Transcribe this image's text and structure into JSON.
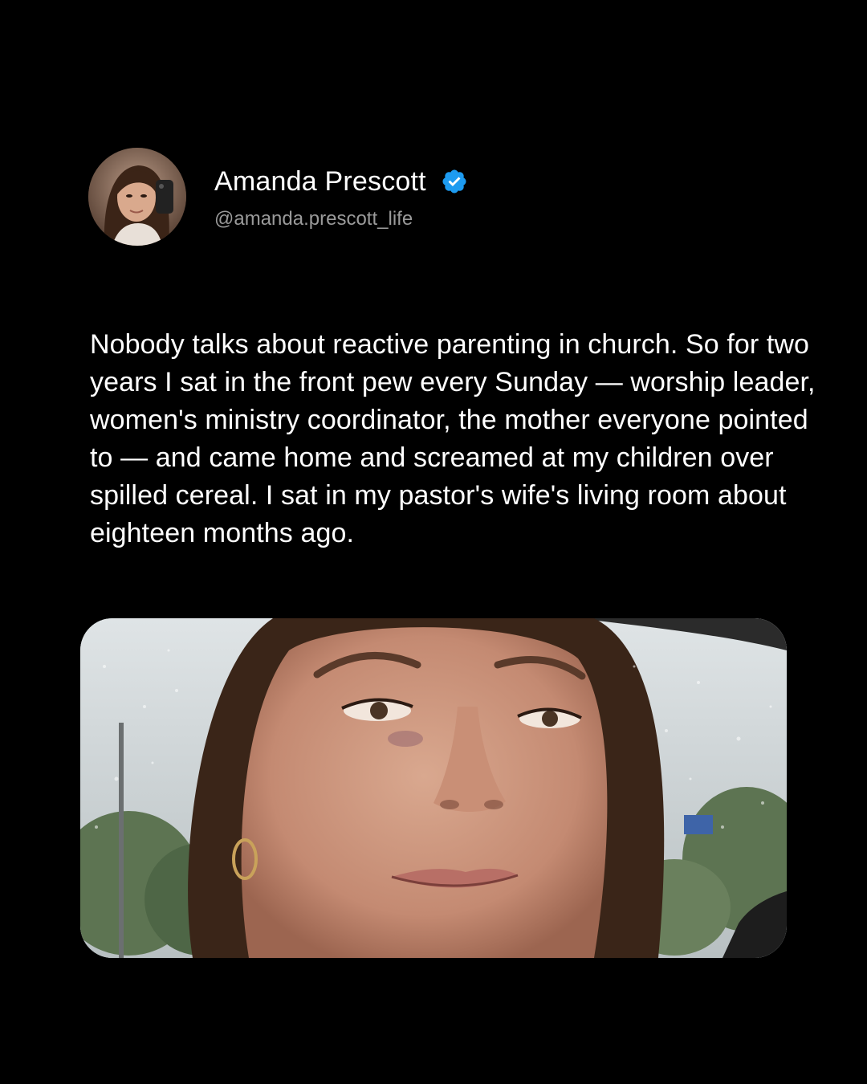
{
  "author": {
    "display_name": "Amanda Prescott",
    "handle": "@amanda.prescott_life",
    "verified": true,
    "verified_color": "#1d9bf0"
  },
  "post": {
    "text": "Nobody talks about reactive parenting in church. So for two years I sat in the front pew every Sunday — worship leader, women's ministry coordinator, the mother everyone pointed to — and came home and screamed at my children over spilled cereal. I sat in my pastor's wife's living room about eighteen months ago."
  },
  "media": {
    "type": "photo",
    "icon": "photo-selfie-in-car-rain"
  },
  "theme": {
    "background": "#000000",
    "text": "#ffffff",
    "muted": "#9a9a9a"
  }
}
